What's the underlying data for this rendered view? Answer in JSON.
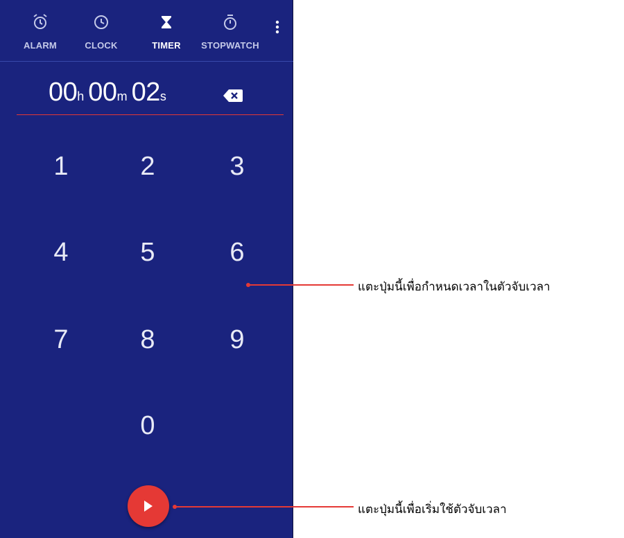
{
  "tabs": [
    {
      "label": "ALARM",
      "icon": "alarm-clock-icon"
    },
    {
      "label": "CLOCK",
      "icon": "clock-icon"
    },
    {
      "label": "TIMER",
      "icon": "hourglass-icon"
    },
    {
      "label": "STOPWATCH",
      "icon": "stopwatch-icon"
    }
  ],
  "active_tab": "TIMER",
  "timer": {
    "hours": "00",
    "hours_unit": "h",
    "minutes": "00",
    "minutes_unit": "m",
    "seconds": "02",
    "seconds_unit": "s"
  },
  "keypad": [
    "1",
    "2",
    "3",
    "4",
    "5",
    "6",
    "7",
    "8",
    "9",
    "0"
  ],
  "annotations": {
    "keypad": "แตะปุ่มนี้เพื่อกำหนดเวลาในตัวจับเวลา",
    "start": "แตะปุ่มนี้เพื่อเริ่มใช้ตัวจับเวลา"
  },
  "colors": {
    "background": "#1a237e",
    "accent": "#e53935",
    "callout": "#e53935"
  }
}
